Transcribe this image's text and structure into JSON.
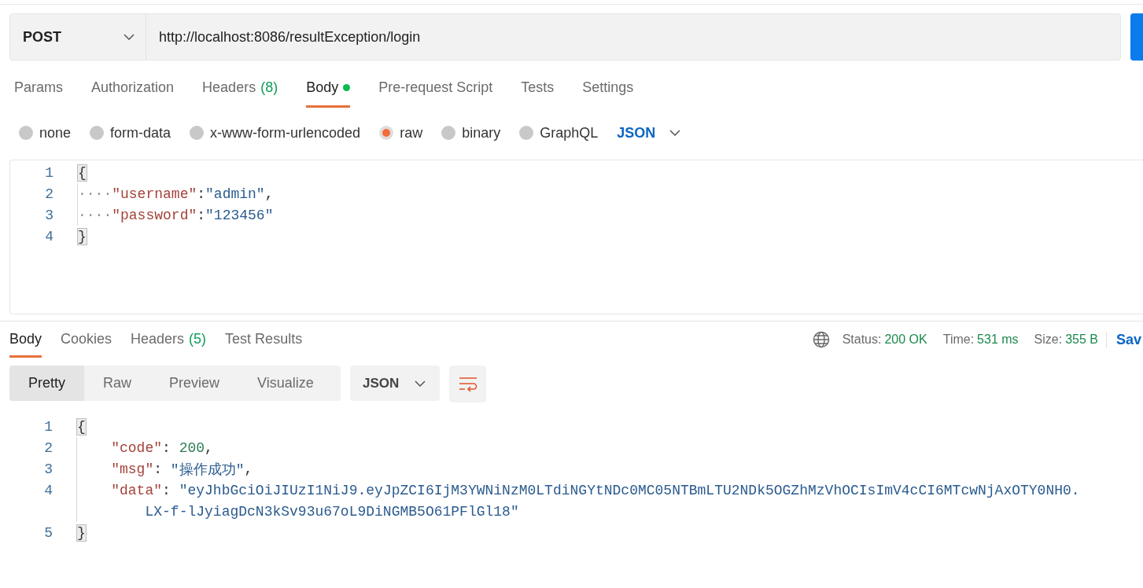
{
  "request": {
    "method": "POST",
    "url": "http://localhost:8086/resultException/login"
  },
  "request_tabs": [
    {
      "label": "Params",
      "selected": false,
      "has_content": false
    },
    {
      "label": "Authorization",
      "selected": false,
      "has_content": false
    },
    {
      "label": "Headers",
      "count": "(8)",
      "selected": false,
      "has_content": false
    },
    {
      "label": "Body",
      "selected": true,
      "has_content": true
    },
    {
      "label": "Pre-request Script",
      "selected": false,
      "has_content": false
    },
    {
      "label": "Tests",
      "selected": false,
      "has_content": false
    },
    {
      "label": "Settings",
      "selected": false,
      "has_content": false
    }
  ],
  "body_types": [
    {
      "label": "none",
      "selected": false
    },
    {
      "label": "form-data",
      "selected": false
    },
    {
      "label": "x-www-form-urlencoded",
      "selected": false
    },
    {
      "label": "raw",
      "selected": true
    },
    {
      "label": "binary",
      "selected": false
    },
    {
      "label": "GraphQL",
      "selected": false
    }
  ],
  "body_format": "JSON",
  "request_body": {
    "lines": [
      {
        "number": "1",
        "tokens": [
          {
            "kind": "bracket",
            "text": "{"
          }
        ]
      },
      {
        "number": "2",
        "tokens": [
          {
            "kind": "whitespace",
            "text": "····"
          },
          {
            "kind": "key",
            "text": "\"username\""
          },
          {
            "kind": "punct",
            "text": ":"
          },
          {
            "kind": "string",
            "text": "\"admin\""
          },
          {
            "kind": "punct",
            "text": ","
          }
        ]
      },
      {
        "number": "3",
        "tokens": [
          {
            "kind": "whitespace",
            "text": "····"
          },
          {
            "kind": "key",
            "text": "\"password\""
          },
          {
            "kind": "punct",
            "text": ":"
          },
          {
            "kind": "string",
            "text": "\"123456\""
          }
        ]
      },
      {
        "number": "4",
        "tokens": [
          {
            "kind": "bracket",
            "text": "}"
          }
        ]
      }
    ]
  },
  "response_tabs": [
    {
      "label": "Body",
      "selected": true
    },
    {
      "label": "Cookies",
      "selected": false
    },
    {
      "label": "Headers",
      "count": "(5)",
      "selected": false
    },
    {
      "label": "Test Results",
      "selected": false
    }
  ],
  "response_meta": {
    "status_label": "Status:",
    "status": "200 OK",
    "time_label": "Time:",
    "time": "531 ms",
    "size_label": "Size:",
    "size": "355 B",
    "save": "Sav"
  },
  "view_modes": [
    {
      "label": "Pretty",
      "selected": true
    },
    {
      "label": "Raw",
      "selected": false
    },
    {
      "label": "Preview",
      "selected": false
    },
    {
      "label": "Visualize",
      "selected": false
    }
  ],
  "response_format": "JSON",
  "response_body": {
    "lines": [
      {
        "number": "1",
        "tokens": [
          {
            "kind": "bracket",
            "text": "{"
          }
        ]
      },
      {
        "number": "2",
        "tokens": [
          {
            "kind": "key",
            "text": "\"code\""
          },
          {
            "kind": "punct",
            "text": ": "
          },
          {
            "kind": "number",
            "text": "200"
          },
          {
            "kind": "punct",
            "text": ","
          }
        ]
      },
      {
        "number": "3",
        "tokens": [
          {
            "kind": "key",
            "text": "\"msg\""
          },
          {
            "kind": "punct",
            "text": ": "
          },
          {
            "kind": "string",
            "text": "\"操作成功\""
          },
          {
            "kind": "punct",
            "text": ","
          }
        ]
      },
      {
        "number": "4",
        "tokens": [
          {
            "kind": "key",
            "text": "\"data\""
          },
          {
            "kind": "punct",
            "text": ": "
          },
          {
            "kind": "string",
            "text": "\"eyJhbGciOiJIUzI1NiJ9.eyJpZCI6IjM3YWNiNzM0LTdiNGYtNDc0MC05NTBmLTU2NDk5OGZhMzVhOCIsImV4cCI6MTcwNjAxOTY0NH0."
          }
        ],
        "continuation": [
          {
            "kind": "string",
            "text": "LX-f-lJyiagDcN3kSv93u67oL9DiNGMB5O61PFlGl18\""
          }
        ]
      },
      {
        "number": "5",
        "tokens": [
          {
            "kind": "bracket",
            "text": "}"
          }
        ]
      }
    ]
  }
}
